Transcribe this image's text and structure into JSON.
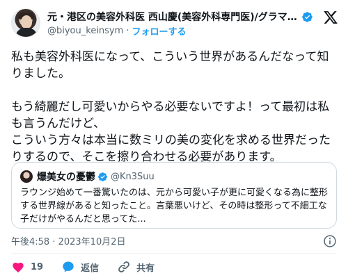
{
  "tweet": {
    "author": {
      "name": "元・港区の美容外科医 西山慶(美容外科専門医)/グラマラス...",
      "handle": "@biyou_keinsym",
      "separator": "·",
      "follow_label": "フォローする",
      "verified": true
    },
    "body_lines": [
      "私も美容外科医になって、こういう世界があるんだなって知りました。",
      "もう綺麗だし可愛いからやる必要ないですよ！って最初は私も言うんだけど、",
      "こういう方々は本当に数ミリの美の変化を求める世界だったりするので、そこを擦り合わせる必要があります。"
    ],
    "quote": {
      "name": "爆美女の憂鬱",
      "handle": "@Kn3Suu",
      "verified": true,
      "text": "ラウンジ始めて一番驚いたのは、元から可愛い子が更に可愛くなる為に整形する世界線があると知ったこと。言葉悪いけど、その時は整形って不細工な子だけがやるんだと思ってた..."
    },
    "timestamp": "午後4:58 · 2023年10月2日",
    "actions": {
      "like_count": "19",
      "reply_label": "返信",
      "share_label": "共有"
    }
  },
  "colors": {
    "accent": "#1d9bf0",
    "like": "#f91880",
    "text": "#0f1419",
    "secondary": "#536471",
    "border": "#cfd9de"
  },
  "icons": [
    "verified-badge-icon",
    "x-logo-icon",
    "info-icon",
    "heart-icon",
    "reply-bubble-icon",
    "share-link-icon"
  ]
}
